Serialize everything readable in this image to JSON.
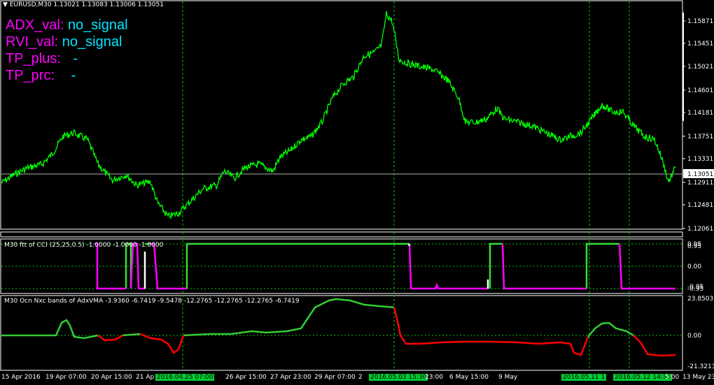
{
  "header": {
    "symbol_line": "EURUSD,M30  1.13021 1.13083 1.13006 1.13051"
  },
  "overlay": [
    {
      "name": "ADX_val:",
      "value": "no_signal"
    },
    {
      "name": "RVI_val:",
      "value": "no_signal"
    },
    {
      "name": "TP_plus:",
      "value": "-"
    },
    {
      "name": "TP_prc:",
      "value": "-"
    }
  ],
  "price_axis": {
    "ticks": [
      "1.15871",
      "1.15451",
      "1.15021",
      "1.14601",
      "1.14181",
      "1.13751",
      "1.13331",
      "1.12911",
      "1.12481",
      "1.12061"
    ],
    "current": "1.13051"
  },
  "cci_panel": {
    "title": "M30 ftt of CCI (25,25,0.5) -1.0000 -1.0000 -1.0000",
    "ticks": [
      "0.95",
      "0.95",
      "0.00",
      "-0.95",
      "-0.95"
    ]
  },
  "adx_panel": {
    "title": "M30 Ocn Nxc bands of AdxVMA  -3.9360 -6.7419 -9.5478 -12.2765 -12.2765 -12.2765 -6.7419",
    "ticks": [
      "23.8503",
      "0.00",
      "-21.3213"
    ]
  },
  "date_axis": [
    {
      "text": "15 Apr 2016",
      "hl": false
    },
    {
      "text": "19 Apr 07:00",
      "hl": false
    },
    {
      "text": "20 Apr 15:00",
      "hl": false
    },
    {
      "text": "21 Ap",
      "hl": false
    },
    {
      "text": "2016.04.25 07:00",
      "hl": true
    },
    {
      "text": "26 Apr 15:00",
      "hl": false
    },
    {
      "text": "27 Apr 23:00",
      "hl": false
    },
    {
      "text": "29 Apr 07:00",
      "hl": false
    },
    {
      "text": "2",
      "hl": false
    },
    {
      "text": "2016.05.03 15:30",
      "hl": true
    },
    {
      "text": "23:00",
      "hl": false
    },
    {
      "text": "6 May 15:00",
      "hl": false
    },
    {
      "text": "9 May",
      "hl": false
    },
    {
      "text": "2016.05.11 1",
      "hl": true
    },
    {
      "text": "2016.05.12 14:30",
      "hl": true
    },
    {
      "text": "5:00",
      "hl": false
    },
    {
      "text": "13 May 23:00",
      "hl": false
    }
  ],
  "colors": {
    "price_line": "#00ff00",
    "grid": "#00cc00",
    "cci_up": "#33dd33",
    "cci_down": "#ff00ff",
    "adx_up": "#33cc33",
    "adx_down": "#ff0000"
  }
}
